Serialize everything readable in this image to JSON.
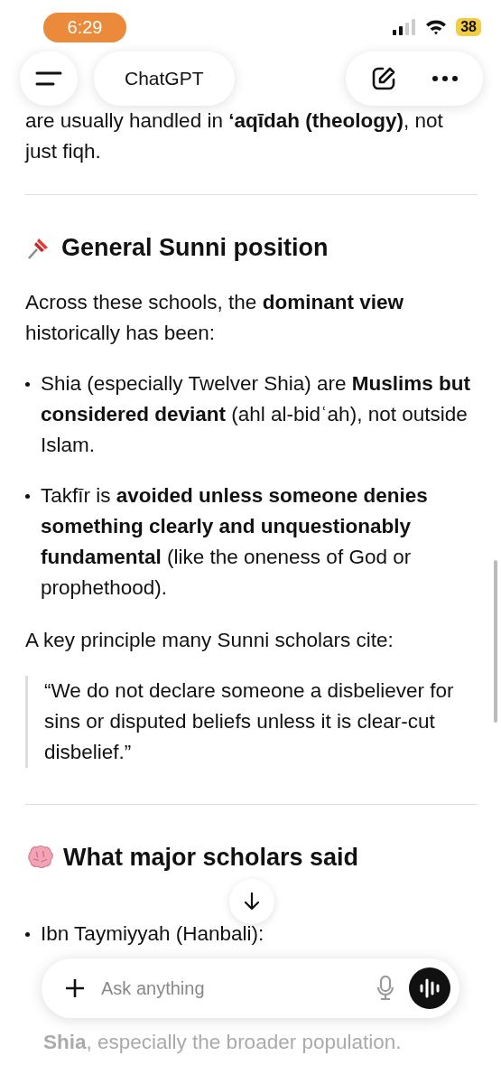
{
  "status_bar": {
    "time": "6:29",
    "battery": "38"
  },
  "header": {
    "title": "ChatGPT"
  },
  "blocks": [
    {
      "kind": "paragraph",
      "text": "are usually handled in **‘aqīdah (theology)**, not just fiqh."
    },
    {
      "kind": "divider"
    },
    {
      "kind": "heading",
      "text": "General Sunni position"
    },
    {
      "kind": "paragraph",
      "text": "Across these schools, the **dominant view** historically has been:"
    },
    {
      "kind": "bullets",
      "items": [
        "Shia (especially Twelver Shia) are **Muslims but considered deviant** (ahl al-bidʿah), not outside Islam.",
        "Takfīr is **avoided unless someone denies something clearly and unquestionably fundamental** (like the oneness of God or prophethood)."
      ]
    },
    {
      "kind": "paragraph",
      "text": "A key principle many Sunni scholars cite:"
    },
    {
      "kind": "quote",
      "text": "“We do not declare someone a disbeliever for sins or disputed beliefs unless it is clear-cut disbelief.”"
    },
    {
      "kind": "divider"
    },
    {
      "kind": "heading",
      "text": "What major scholars said"
    },
    {
      "kind": "scroll"
    },
    {
      "kind": "bullets",
      "items": [
        "Ibn Taymiyyah (Hanbali):"
      ]
    }
  ],
  "composer": {
    "placeholder": "Ask anything"
  },
  "trailing_text": "**Shia**, especially the broader population."
}
